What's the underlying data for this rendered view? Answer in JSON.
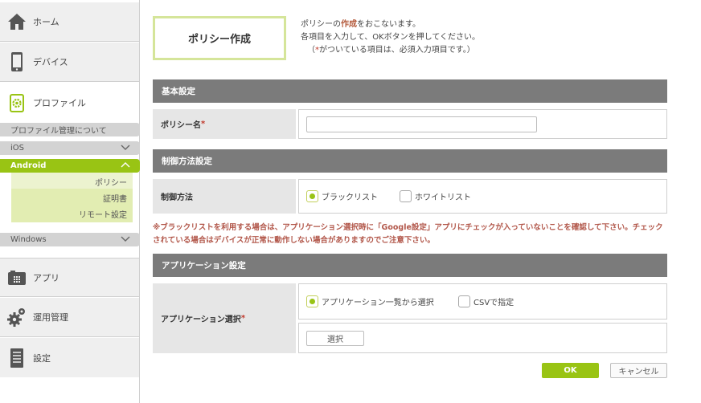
{
  "sidebar": {
    "home": "ホーム",
    "device": "デバイス",
    "profile": "プロファイル",
    "profile_about": "プロファイル管理について",
    "ios": "iOS",
    "android": "Android",
    "android_items": [
      "ポリシー",
      "証明書",
      "リモート設定"
    ],
    "windows": "Windows",
    "app": "アプリ",
    "operation": "運用管理",
    "settings": "設定"
  },
  "page": {
    "title": "ポリシー作成",
    "intro_line1_pre": "ポリシーの",
    "intro_line1_hl": "作成",
    "intro_line1_post": "をおこないます。",
    "intro_line2": "各項目を入力して、OKボタンを押してください。",
    "intro_line3_pre": "（",
    "intro_line3_star": "*",
    "intro_line3_post": "がついている項目は、必須入力項目です。）"
  },
  "basic": {
    "heading": "基本設定",
    "policy_name_label": "ポリシー名",
    "required_mark": "*",
    "policy_name_value": ""
  },
  "control": {
    "heading": "制御方法設定",
    "label": "制御方法",
    "blacklist": "ブラックリスト",
    "whitelist": "ホワイトリスト",
    "selected": "blacklist",
    "warning": "※ブラックリストを利用する場合は、アプリケーション選択時に「Google設定」アプリにチェックが入っていないことを確認して下さい。チェックされている場合はデバイスが正常に動作しない場合がありますのでご注意下さい。"
  },
  "application": {
    "heading": "アプリケーション設定",
    "label": "アプリケーション選択",
    "required_mark": "*",
    "from_list": "アプリケーション一覧から選択",
    "csv": "CSVで指定",
    "selected": "from_list",
    "select_button": "選択"
  },
  "actions": {
    "ok": "OK",
    "cancel": "キャンセル"
  },
  "colors": {
    "accent": "#99c414",
    "section_header": "#7b7b7b",
    "warning": "#b2574a"
  }
}
